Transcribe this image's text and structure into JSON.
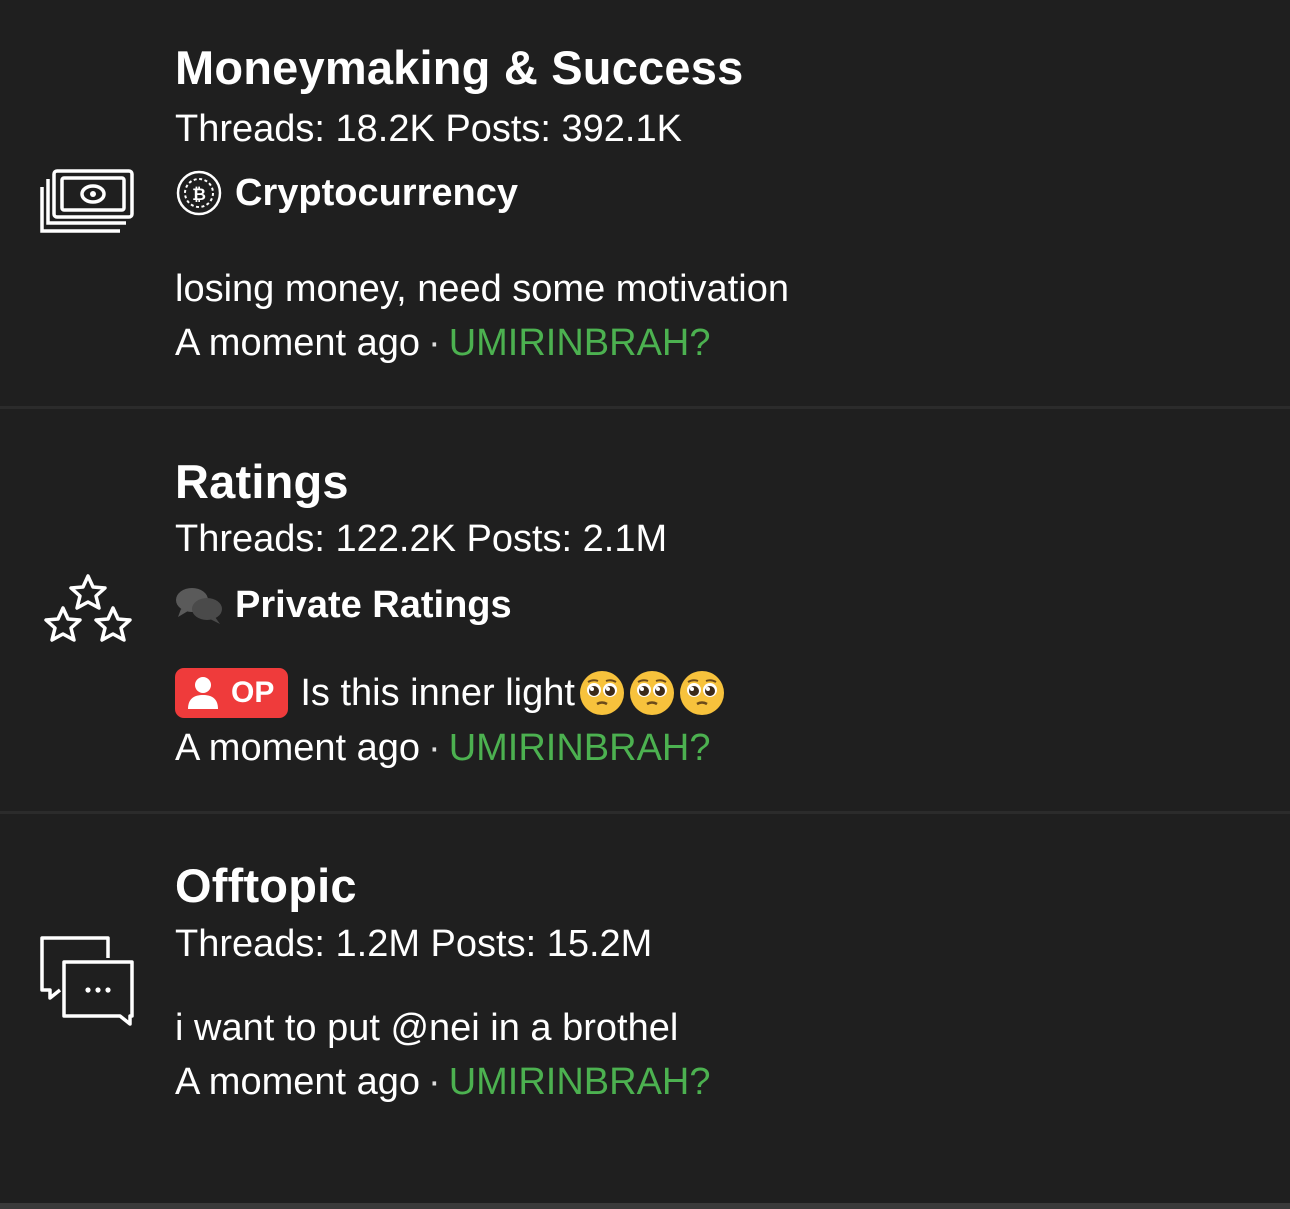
{
  "forums": [
    {
      "icon": "money-stack-icon",
      "title": "Moneymaking & Success",
      "stats": "Threads: 18.2K Posts: 392.1K",
      "subforum": {
        "icon": "bitcoin-coin-icon",
        "label": "Cryptocurrency"
      },
      "last_post_title": "losing money, need some motivation",
      "time": "A moment ago",
      "separator": "·",
      "author": "UMIRINBRAH?"
    },
    {
      "icon": "stars-icon",
      "title": "Ratings",
      "stats": "Threads: 122.2K Posts: 2.1M",
      "subforum": {
        "icon": "chat-bubbles-icon",
        "label": "Private Ratings"
      },
      "badge": "OP",
      "last_post_title": "Is this inner light",
      "last_post_emoji": [
        "pleading-face-emoji",
        "pleading-face-emoji",
        "pleading-face-emoji"
      ],
      "time": "A moment ago",
      "separator": "·",
      "author": "UMIRINBRAH?"
    },
    {
      "icon": "conversation-icon",
      "title": "Offtopic",
      "stats": "Threads: 1.2M Posts: 15.2M",
      "last_post_title": "i want to put @nei in a brothel",
      "time": "A moment ago",
      "separator": "·",
      "author": "UMIRINBRAH?"
    }
  ],
  "colors": {
    "background": "#1f1f1f",
    "author": "#4cb150",
    "op_badge": "#ef3b3b",
    "divider": "#2b2b2b"
  }
}
